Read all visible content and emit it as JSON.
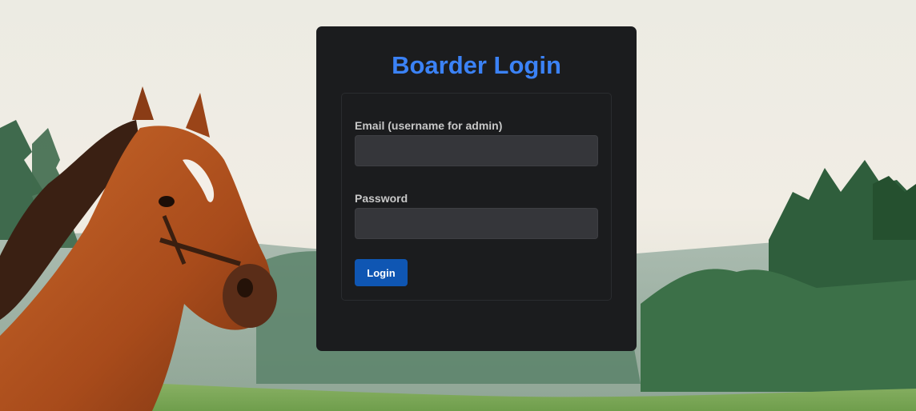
{
  "login": {
    "title": "Boarder Login",
    "email_label": "Email (username for admin)",
    "email_value": "",
    "password_label": "Password",
    "password_value": "",
    "submit_label": "Login"
  },
  "colors": {
    "title": "#3b82f6",
    "card_background": "#1b1c1e",
    "input_background": "#35363a",
    "button_background": "#0f56b3"
  }
}
